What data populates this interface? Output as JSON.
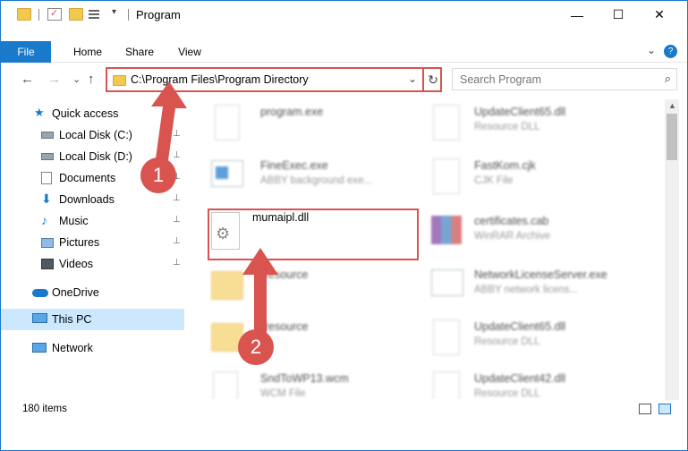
{
  "window": {
    "title": "Program",
    "minimize": "—",
    "maximize": "☐",
    "close": "✕"
  },
  "ribbon": {
    "tabs": [
      "File",
      "Home",
      "Share",
      "View"
    ],
    "expand": "⌄",
    "help": "?"
  },
  "nav": {
    "back": "←",
    "forward": "→",
    "recent": "⌄",
    "up": "↑"
  },
  "address": {
    "path": "C:\\Program Files\\Program Directory",
    "chevron": "⌄",
    "refresh": "↻"
  },
  "search": {
    "placeholder": "Search Program",
    "icon": "⌕"
  },
  "sidebar": {
    "quick_access": "Quick access",
    "items": [
      {
        "label": "Local Disk (C:)",
        "pinned": true,
        "icon": "drive-icon"
      },
      {
        "label": "Local Disk (D:)",
        "pinned": true,
        "icon": "drive-icon"
      },
      {
        "label": "Documents",
        "pinned": true,
        "icon": "documents-icon"
      },
      {
        "label": "Downloads",
        "pinned": true,
        "icon": "downloads-icon"
      },
      {
        "label": "Music",
        "pinned": true,
        "icon": "music-icon"
      },
      {
        "label": "Pictures",
        "pinned": true,
        "icon": "pictures-icon"
      },
      {
        "label": "Videos",
        "pinned": true,
        "icon": "videos-icon"
      }
    ],
    "onedrive": "OneDrive",
    "this_pc": "This PC",
    "network": "Network",
    "pin_glyph": "📌"
  },
  "files": {
    "left": [
      {
        "name": "program.exe",
        "type": ""
      },
      {
        "name": "FineExec.exe",
        "type": "ABBY background exe..."
      },
      {
        "name": "mumaipl.dll",
        "type": ""
      },
      {
        "name": "Resource",
        "type": ""
      },
      {
        "name": "Resource",
        "type": ""
      },
      {
        "name": "SndToWP13.wcm",
        "type": "WCM File"
      }
    ],
    "right": [
      {
        "name": "UpdateClient65.dll",
        "type": "Resource DLL"
      },
      {
        "name": "FastKom.cjk",
        "type": "CJK File"
      },
      {
        "name": "certificates.cab",
        "type": "WinRAR Archive"
      },
      {
        "name": "NetworkLicenseServer.exe",
        "type": "ABBY network licens..."
      },
      {
        "name": "UpdateClient65.dll",
        "type": "Resource DLL"
      },
      {
        "name": "UpdateClient42.dll",
        "type": "Resource DLL"
      }
    ]
  },
  "status": {
    "count": "180 items"
  },
  "annotations": {
    "step1": "1",
    "step2": "2",
    "color": "#d9534f"
  },
  "colors": {
    "accent": "#1979ca",
    "highlight": "#d9534f",
    "selected_nav": "#cce8ff"
  }
}
